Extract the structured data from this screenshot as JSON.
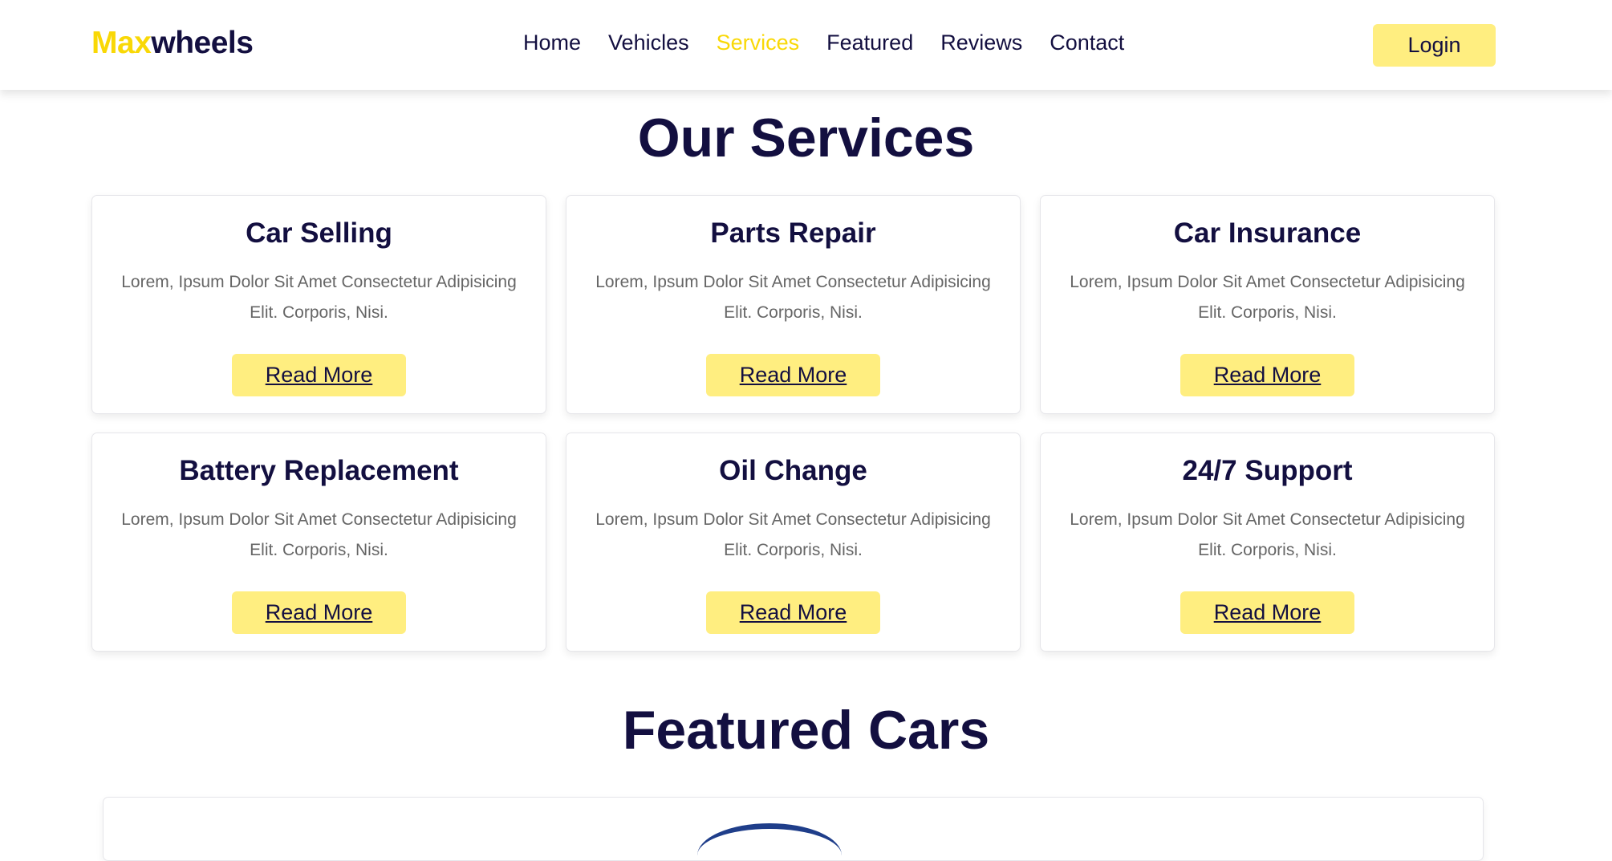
{
  "header": {
    "logo_part1": "Max",
    "logo_part2": "wheels",
    "nav": [
      {
        "label": "Home"
      },
      {
        "label": "Vehicles"
      },
      {
        "label": "Services"
      },
      {
        "label": "Featured"
      },
      {
        "label": "Reviews"
      },
      {
        "label": "Contact"
      }
    ],
    "active_nav": "Services",
    "login_label": "Login"
  },
  "services": {
    "heading_part1": "Our",
    "heading_part2": "Services",
    "cards": [
      {
        "title": "Car Selling",
        "text": "Lorem, Ipsum Dolor Sit Amet Consectetur Adipisicing Elit. Corporis, Nisi.",
        "button": "Read More"
      },
      {
        "title": "Parts Repair",
        "text": "Lorem, Ipsum Dolor Sit Amet Consectetur Adipisicing Elit. Corporis, Nisi.",
        "button": "Read More"
      },
      {
        "title": "Car Insurance",
        "text": "Lorem, Ipsum Dolor Sit Amet Consectetur Adipisicing Elit. Corporis, Nisi.",
        "button": "Read More"
      },
      {
        "title": "Battery Replacement",
        "text": "Lorem, Ipsum Dolor Sit Amet Consectetur Adipisicing Elit. Corporis, Nisi.",
        "button": "Read More"
      },
      {
        "title": "Oil Change",
        "text": "Lorem, Ipsum Dolor Sit Amet Consectetur Adipisicing Elit. Corporis, Nisi.",
        "button": "Read More"
      },
      {
        "title": "24/7 Support",
        "text": "Lorem, Ipsum Dolor Sit Amet Consectetur Adipisicing Elit. Corporis, Nisi.",
        "button": "Read More"
      }
    ]
  },
  "featured": {
    "heading_part1": "Featured",
    "heading_part2": "Cars"
  },
  "colors": {
    "accent": "#f9d806",
    "button_bg": "#ffee80",
    "dark": "#130f40",
    "text_muted": "#666666"
  }
}
